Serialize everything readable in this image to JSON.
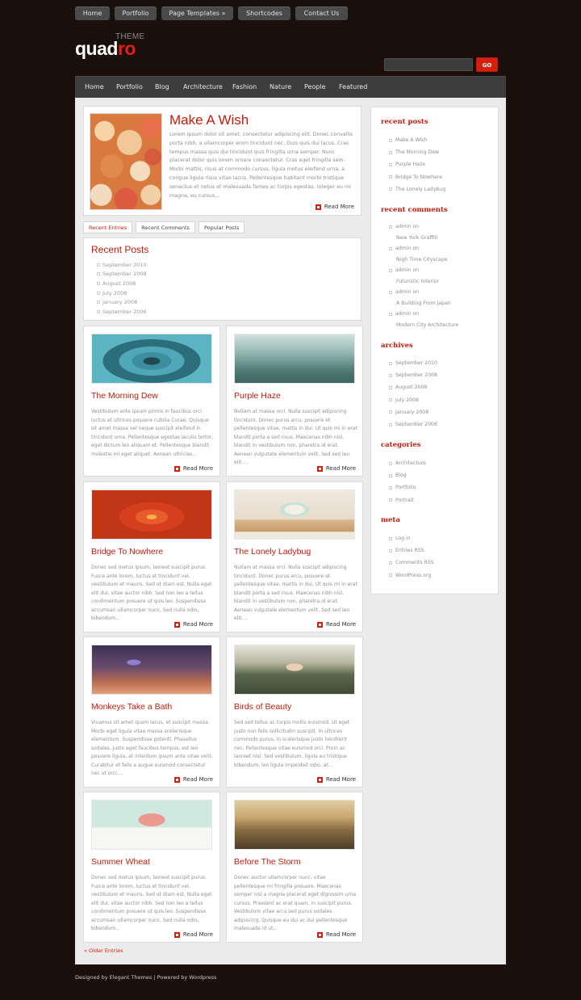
{
  "top_nav": {
    "items": [
      "Home",
      "Portfolio",
      "Page Templates »",
      "Shortcodes",
      "Contact Us"
    ]
  },
  "logo": {
    "theme": "THEME",
    "word_white": "quad",
    "word_red": "ro"
  },
  "search": {
    "value": "",
    "placeholder": "",
    "button": "GO"
  },
  "main_nav": {
    "items": [
      "Home",
      "Portfolio",
      "Blog",
      "Architecture",
      "Fashion",
      "Nature",
      "People",
      "Featured"
    ]
  },
  "featured": {
    "title": "Make A Wish",
    "excerpt": "Lorem ipsum dolor sit amet, consectetur adipiscing elit. Donec convallis porta nibh, a ullamcorper enim tincidunt nec. Duis quis dui lacus. Cras tempus massa quis dui tincidunt quis fringilla urna semper. Nunc placerat dolor quis lorem ornare consectetur. Cras eget fringilla sem. Morbi mattis, risus at commodo cursus, ligula metus eleifend urna, a congue ligula risus vitae lacus. Pellentesque habitant morbi tristique senectus et netus et malesuada fames ac turpis egestas. Integer eu mi magna, eu cursus...",
    "read_more": "Read More"
  },
  "tabs": {
    "items": [
      "Recent Entries",
      "Recent Comments",
      "Popular Posts"
    ],
    "active": "Recent Entries"
  },
  "recent_posts_widget": {
    "title": "Recent Posts",
    "items": [
      "September 2010",
      "September 2008",
      "August 2008",
      "July 2008",
      "January 2008",
      "September 2006"
    ]
  },
  "posts": [
    {
      "title": "The Morning Dew",
      "excerpt": "Vestibulum ante ipsum primis in faucibus orci luctus et ultrices posuere cubilia Curae; Quisque sit amet massa vel neque suscipit eleifend in tincidunt urna. Pellentesque egestas iaculis tortor, eget dictum leo aliquam et. Pellentesque blandit molestie mi eget aliquet. Aenean ultricies...",
      "read_more": "Read More"
    },
    {
      "title": "Purple Haze",
      "excerpt": "Nullam at massa orci. Nulla suscipit adipiscing tincidunt. Donec purus arcu, posuere et pellentesque vitae, mattis in dui. Ut quis mi in erat blandit porta a sed risus. Maecenas nibh nisl, blandit in vestibulum non, pharetra id erat. Aenean vulputate elementum velit. Sed sed leo elit....",
      "read_more": "Read More"
    },
    {
      "title": "Bridge To Nowhere",
      "excerpt": "Donec sed metus ipsum, laoreet suscipit purus. Fusce ante lorem, luctus et tincidunt vel, vestibulum et mauris. Sed ut diam est. Nulla eget elit dui, vitae auctor nibh. Sed non leo a tellus condimentum posuere ut quis leo. Suspendisse accumsan ullamcorper nunc. Sed nulla odio, bibendum...",
      "read_more": "Read More"
    },
    {
      "title": "The Lonely Ladybug",
      "excerpt": "Nullam at massa orci. Nulla suscipit adipiscing tincidunt. Donec purus arcu, posuere et pellentesque vitae, mattis in dui. Ut quis mi in erat blandit porta a sed risus. Maecenas nibh nisl, blandit in vestibulum non, pharetra id erat. Aenean vulputate elementum velit. Sed sed leo elit....",
      "read_more": "Read More"
    },
    {
      "title": "Monkeys Take a Bath",
      "excerpt": "Vivamus sit amet quam lacus, et suscipit massa. Morbi eget ligula vitae massa scelerisque elementum. Suspendisse potenti. Phasellus sodales, justo eget faucibus tempus, est leo posuere ligula, at interdum ipsum ante vitae velit. Curabitur et felis a augue euismod consectetur nec ut orci....",
      "read_more": "Read More"
    },
    {
      "title": "Birds of Beauty",
      "excerpt": "Sed sed tellus ac turpis mollis euismod. Ut eget justo non felis sollicitudin suscipit. In ultrices commodo purus, in scelerisque justo hendrerit nec. Pellentesque vitae euismod orci. Proin ac laoreet nisl. Sed vestibulum, ligula eu tristique bibendum, leo ligula imperdiet odio, at...",
      "read_more": "Read More"
    },
    {
      "title": "Summer Wheat",
      "excerpt": "Donec sed metus ipsum, laoreet suscipit purus. Fusce ante lorem, luctus et tincidunt vel, vestibulum et mauris. Sed ut diam est. Nulla eget elit dui, vitae auctor nibh. Sed non leo a tellus condimentum posuere ut quis leo. Suspendisse accumsan ullamcorper nunc. Sed nulla odio, bibendum...",
      "read_more": "Read More"
    },
    {
      "title": "Before The Storm",
      "excerpt": "Donec auctor ullamcorper nunc, vitae pellentesque mi fringilla posuere. Maecenas semper nisl a magna placerat eget dignissim urna cursus. Praesent ac erat quam, in suscipit purus. Vestibulum vitae arcu sed purus sodales adipiscing. Quisque eu dui ac dui pellentesque malesuada id ut...",
      "read_more": "Read More"
    }
  ],
  "older_entries": "« Older Entries",
  "sidebar": {
    "recent_posts": {
      "title": "recent posts",
      "items": [
        "Make A Wish",
        "The Morning Dew",
        "Purple Haze",
        "Bridge To Nowhere",
        "The Lonely Ladybug"
      ]
    },
    "recent_comments": {
      "title": "recent comments",
      "items": [
        {
          "author": "admin on",
          "post": "New York Graffiti"
        },
        {
          "author": "admin on",
          "post": "Nigh Time Cityscape"
        },
        {
          "author": "admin on",
          "post": "Futuristic Interior"
        },
        {
          "author": "admin on",
          "post": "A Building From Japan"
        },
        {
          "author": "admin on",
          "post": "Modern City Architecture"
        }
      ]
    },
    "archives": {
      "title": "archives",
      "items": [
        "September 2010",
        "September 2008",
        "August 2008",
        "July 2008",
        "January 2008",
        "September 2006"
      ]
    },
    "categories": {
      "title": "categories",
      "items": [
        "Architecture",
        "Blog",
        "Portfolio",
        "Portrait"
      ]
    },
    "meta": {
      "title": "meta",
      "items": [
        "Log in",
        "Entries RSS",
        "Comments RSS",
        "WordPress.org"
      ]
    }
  },
  "footer": "Designed by Elegant Themes | Powered by Wordpress",
  "colors": {
    "accent": "#c81a0a",
    "button_red": "#d6200c",
    "background": "#1a0f0b",
    "nav": "#3d3d3d"
  }
}
